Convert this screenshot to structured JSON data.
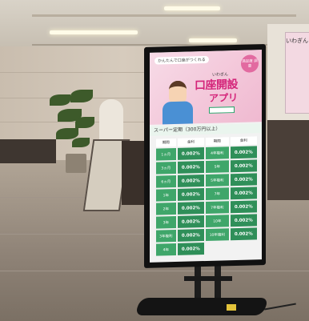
{
  "banner": {
    "tagline": "かんたんで口座がつくれる",
    "badge": "満足度\n調査",
    "app_subtitle": "いわぎん",
    "app_title_line1": "口座開設",
    "app_title_line2": "アプリ"
  },
  "rate_table": {
    "title": "スーパー定期（300万円以上）",
    "headers": [
      "期間",
      "金利",
      "期間",
      "金利"
    ],
    "rows": [
      [
        "1ヵ月",
        "0.002%",
        "4年複利",
        "0.002%"
      ],
      [
        "3ヵ月",
        "0.002%",
        "5年",
        "0.002%"
      ],
      [
        "6ヵ月",
        "0.002%",
        "5年複利",
        "0.002%"
      ],
      [
        "1年",
        "0.002%",
        "7年",
        "0.002%"
      ],
      [
        "2年",
        "0.002%",
        "7年複利",
        "0.002%"
      ],
      [
        "3年",
        "0.002%",
        "10年",
        "0.002%"
      ],
      [
        "3年複利",
        "0.002%",
        "10年複利",
        "0.002%"
      ],
      [
        "4年",
        "0.002%",
        "",
        ""
      ]
    ]
  },
  "background": {
    "poster_label": "いわぎん"
  }
}
